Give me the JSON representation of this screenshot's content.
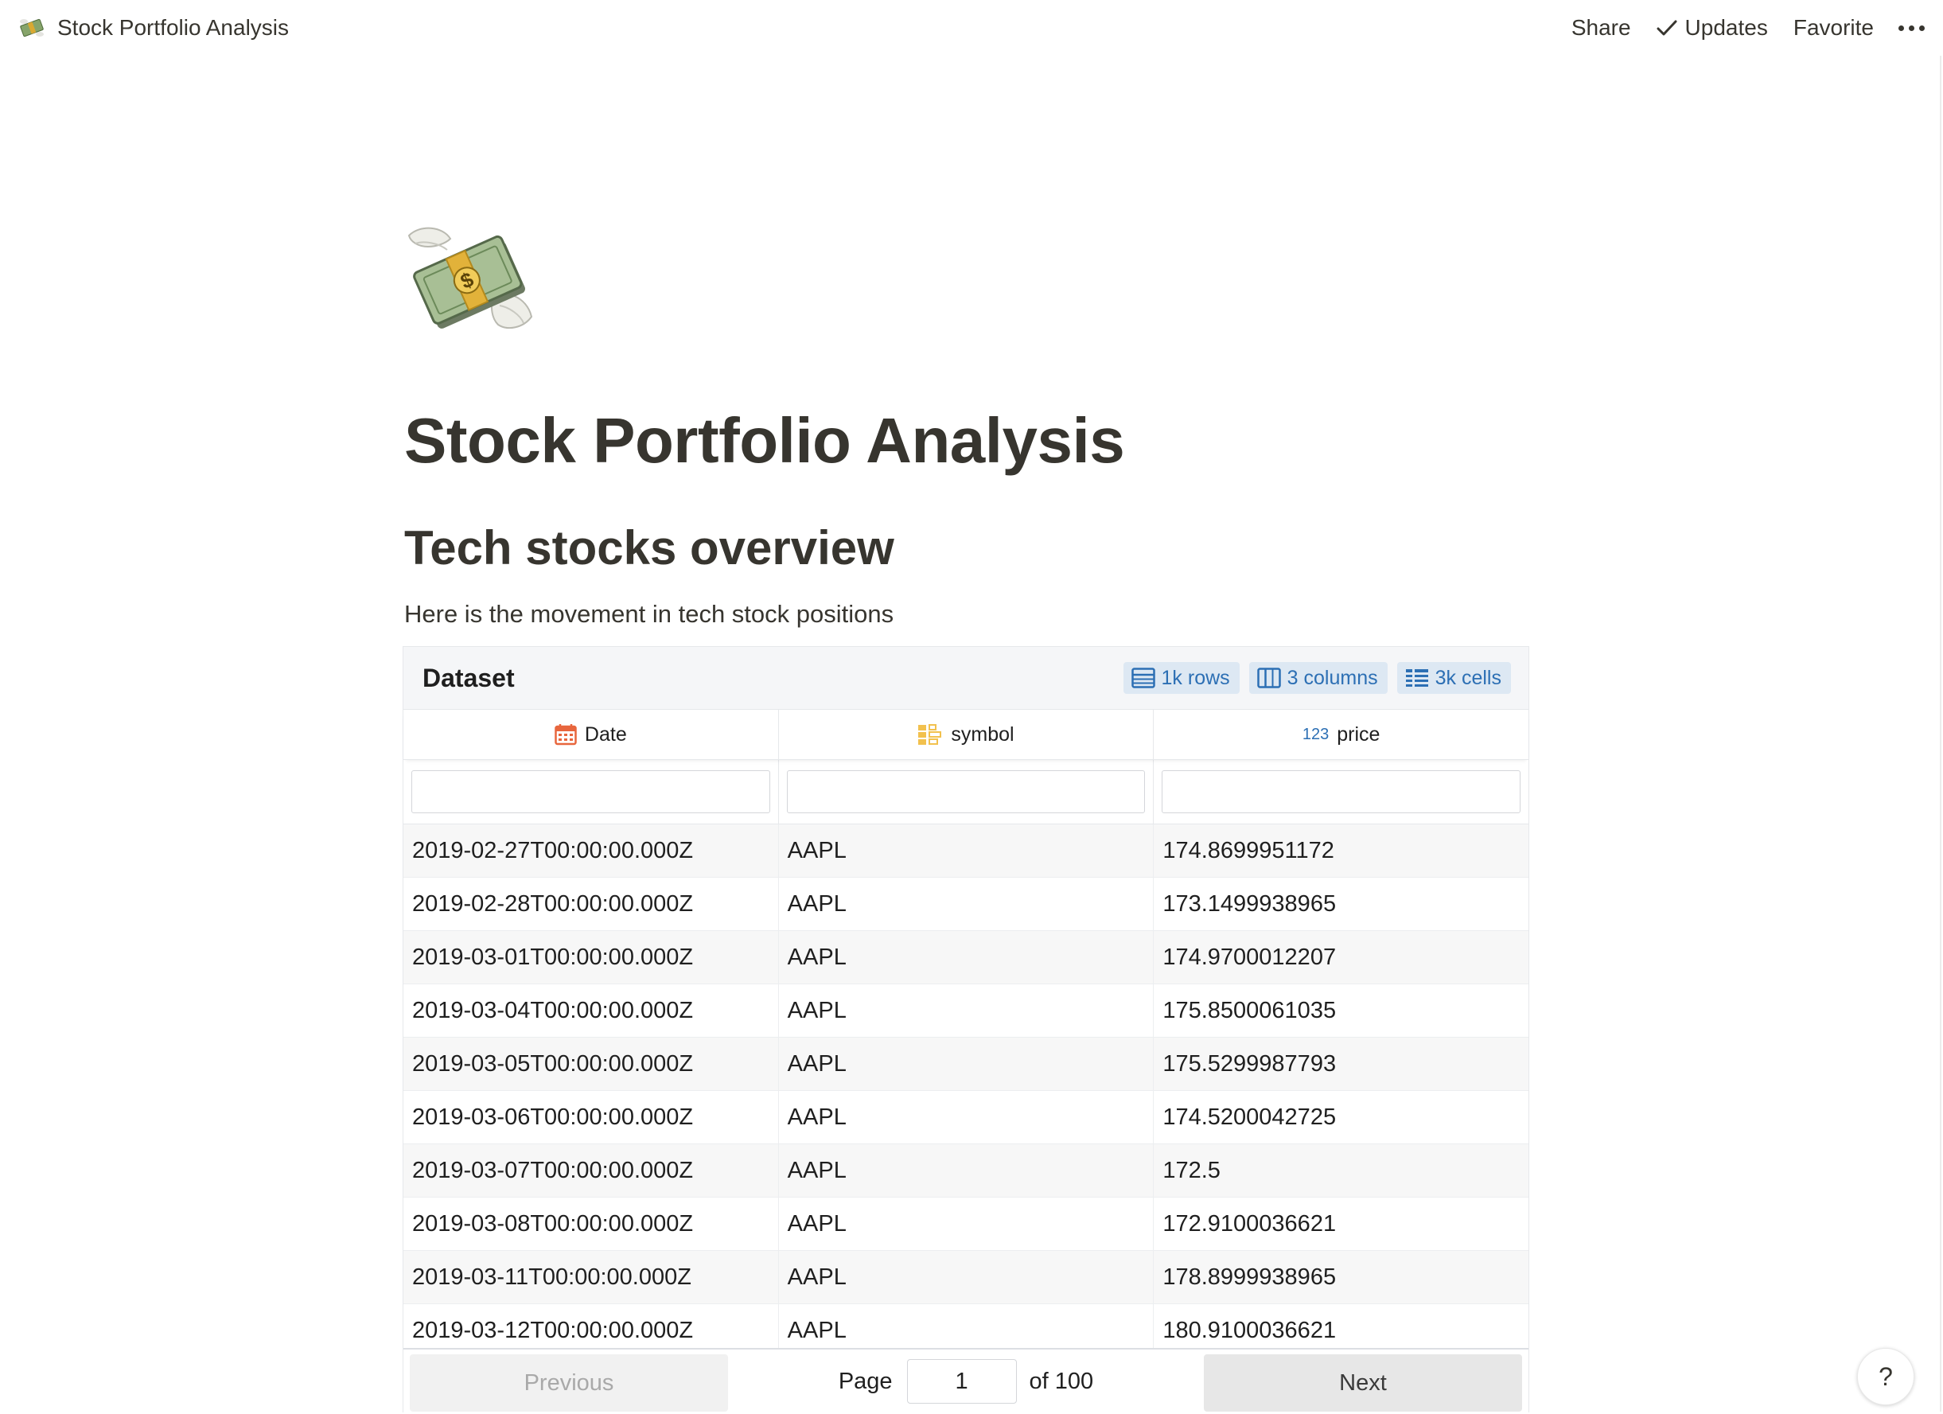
{
  "topbar": {
    "title": "Stock Portfolio Analysis",
    "page_icon": "money-with-wings-icon",
    "actions": {
      "share": "Share",
      "updates": "Updates",
      "favorite": "Favorite"
    }
  },
  "page": {
    "icon": "money-with-wings-icon",
    "title": "Stock Portfolio Analysis",
    "section_title": "Tech stocks overview",
    "section_text": "Here is the movement in tech stock positions"
  },
  "dataset": {
    "title": "Dataset",
    "badges": {
      "rows": "1k rows",
      "columns": "3 columns",
      "cells": "3k cells"
    },
    "columns": [
      {
        "label": "Date",
        "type_icon": "calendar-icon"
      },
      {
        "label": "symbol",
        "type_icon": "category-icon"
      },
      {
        "label": "price",
        "type_tag": "123"
      }
    ],
    "filters": [
      "",
      "",
      ""
    ],
    "rows": [
      [
        "2019-02-27T00:00:00.000Z",
        "AAPL",
        "174.8699951172"
      ],
      [
        "2019-02-28T00:00:00.000Z",
        "AAPL",
        "173.1499938965"
      ],
      [
        "2019-03-01T00:00:00.000Z",
        "AAPL",
        "174.9700012207"
      ],
      [
        "2019-03-04T00:00:00.000Z",
        "AAPL",
        "175.8500061035"
      ],
      [
        "2019-03-05T00:00:00.000Z",
        "AAPL",
        "175.5299987793"
      ],
      [
        "2019-03-06T00:00:00.000Z",
        "AAPL",
        "174.5200042725"
      ],
      [
        "2019-03-07T00:00:00.000Z",
        "AAPL",
        "172.5"
      ],
      [
        "2019-03-08T00:00:00.000Z",
        "AAPL",
        "172.9100036621"
      ],
      [
        "2019-03-11T00:00:00.000Z",
        "AAPL",
        "178.8999938965"
      ],
      [
        "2019-03-12T00:00:00.000Z",
        "AAPL",
        "180.9100036621"
      ]
    ],
    "pager": {
      "previous": "Previous",
      "page_label": "Page",
      "page_value": "1",
      "of_label": "of 100",
      "next": "Next"
    }
  },
  "help": {
    "label": "?"
  },
  "colors": {
    "text": "#37352f",
    "badge_bg": "#dde8f3",
    "badge_text": "#2c6fb4",
    "calendar_icon": "#e8663d",
    "category_icon": "#f2c14e"
  }
}
